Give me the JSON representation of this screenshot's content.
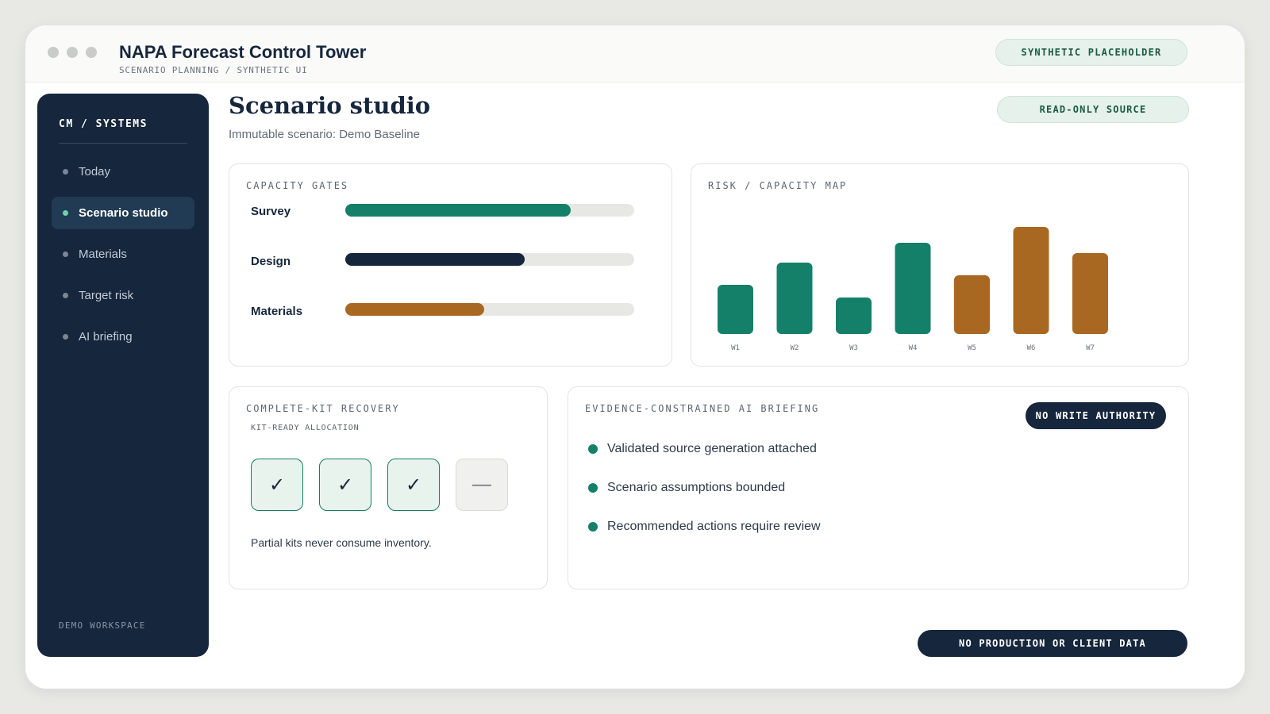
{
  "app": {
    "title": "NAPA Forecast Control Tower",
    "subtitle": "SCENARIO PLANNING / SYNTHETIC UI",
    "badge": "SYNTHETIC PLACEHOLDER"
  },
  "sidebar": {
    "brand": "CM / SYSTEMS",
    "items": [
      {
        "label": "Today",
        "active": false
      },
      {
        "label": "Scenario studio",
        "active": true
      },
      {
        "label": "Materials",
        "active": false
      },
      {
        "label": "Target risk",
        "active": false
      },
      {
        "label": "AI briefing",
        "active": false
      }
    ],
    "footer": "DEMO WORKSPACE"
  },
  "page": {
    "title": "Scenario studio",
    "subtitle": "Immutable scenario: Demo Baseline",
    "source_badge": "READ-ONLY SOURCE"
  },
  "capacity_gates": {
    "label": "CAPACITY GATES",
    "gates": [
      {
        "label": "Survey",
        "fraction": 0.78,
        "color": "#15806a"
      },
      {
        "label": "Design",
        "fraction": 0.62,
        "color": "#16263c"
      },
      {
        "label": "Materials",
        "fraction": 0.48,
        "color": "#a86822"
      }
    ]
  },
  "risk_map": {
    "label": "RISK / CAPACITY MAP"
  },
  "chart_data": {
    "type": "bar",
    "title": "",
    "categories": [
      "W1",
      "W2",
      "W3",
      "W4",
      "W5",
      "W6",
      "W7"
    ],
    "values": [
      62,
      90,
      46,
      115,
      74,
      135,
      102
    ],
    "colors": [
      "#15806a",
      "#15806a",
      "#15806a",
      "#15806a",
      "#a86822",
      "#a86822",
      "#a86822"
    ],
    "ylim": [
      0,
      150
    ],
    "grid": false,
    "xlabel": "",
    "ylabel": ""
  },
  "kit_recovery": {
    "label": "COMPLETE-KIT RECOVERY",
    "sublabel": "KIT-READY ALLOCATION",
    "kits": [
      {
        "state": "ready",
        "glyph": "✓"
      },
      {
        "state": "ready",
        "glyph": "✓"
      },
      {
        "state": "ready",
        "glyph": "✓"
      },
      {
        "state": "pending",
        "glyph": "—"
      }
    ],
    "note": "Partial kits never consume inventory."
  },
  "ai_briefing": {
    "label": "EVIDENCE-CONSTRAINED AI BRIEFING",
    "badge": "NO WRITE AUTHORITY",
    "items": [
      "Validated source generation attached",
      "Scenario assumptions bounded",
      "Recommended actions require review"
    ]
  },
  "footer_badge": "NO PRODUCTION OR CLIENT DATA"
}
